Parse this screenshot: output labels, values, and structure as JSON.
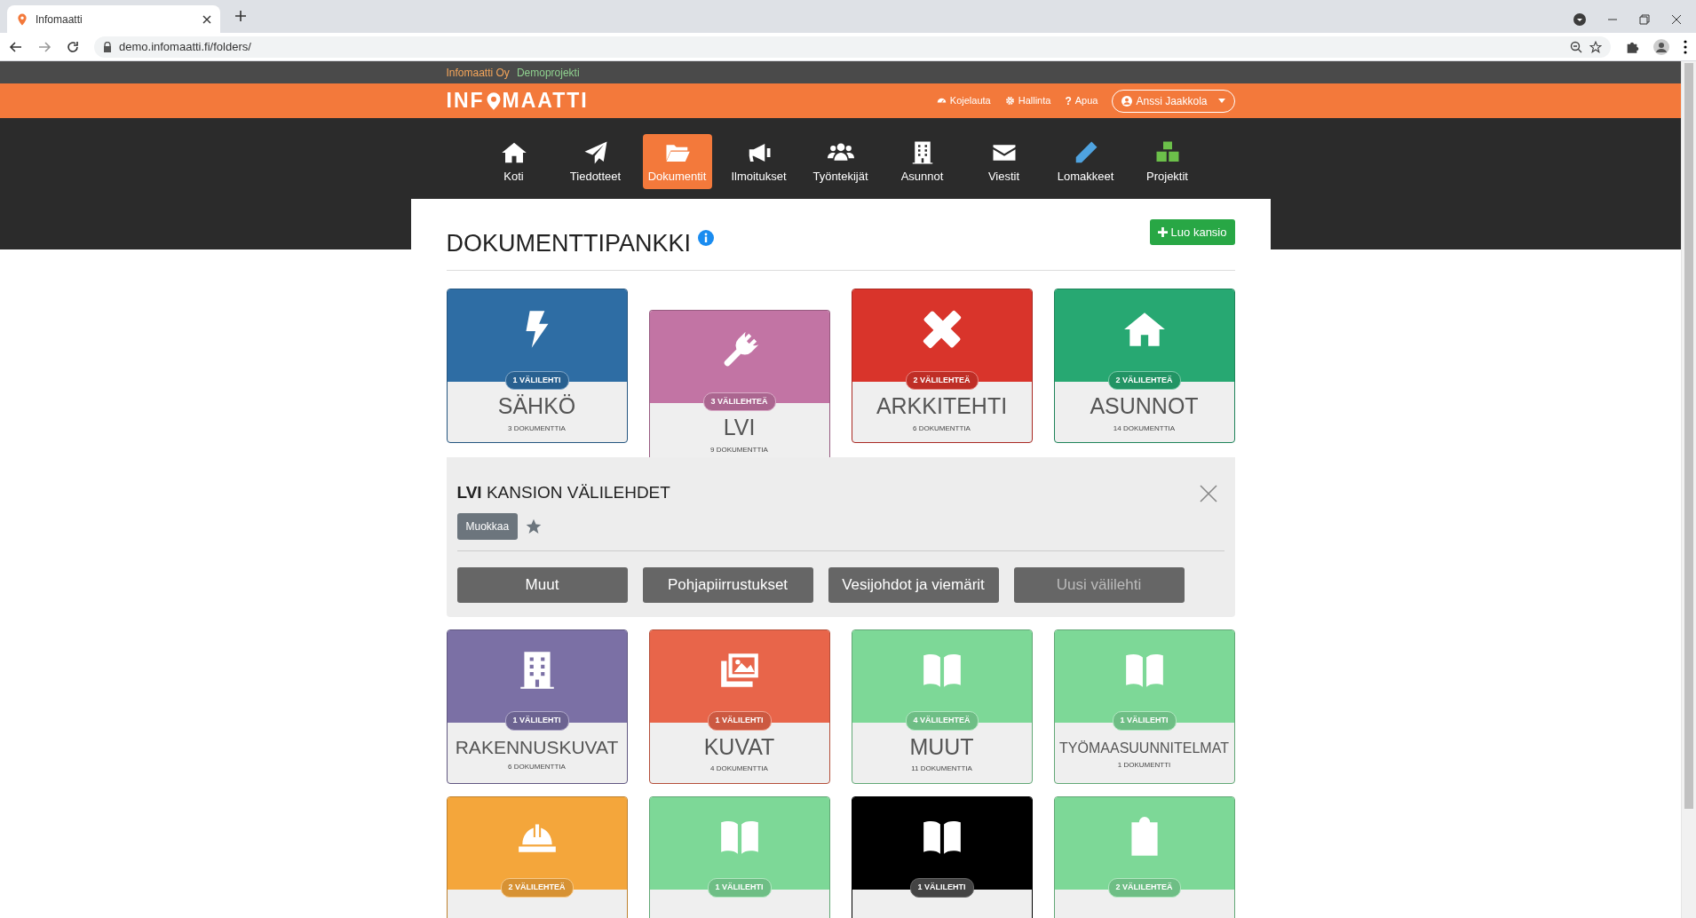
{
  "browser": {
    "tab_title": "Infomaatti",
    "url": "demo.infomaatti.fi/folders/"
  },
  "topbar": {
    "company": "Infomaatti Oy",
    "project": "Demoprojekti"
  },
  "header": {
    "logo_parts": [
      "INF",
      "MAATTI"
    ],
    "links": [
      {
        "label": "Kojelauta"
      },
      {
        "label": "Hallinta"
      },
      {
        "label": "Apua",
        "glyph": "?"
      }
    ],
    "user": "Anssi Jaakkola"
  },
  "nav": [
    {
      "label": "Koti",
      "selected": false
    },
    {
      "label": "Tiedotteet",
      "selected": false
    },
    {
      "label": "Dokumentit",
      "selected": true
    },
    {
      "label": "Ilmoitukset",
      "selected": false
    },
    {
      "label": "Työntekijät",
      "selected": false
    },
    {
      "label": "Asunnot",
      "selected": false
    },
    {
      "label": "Viestit",
      "selected": false
    },
    {
      "label": "Lomakkeet",
      "selected": false
    },
    {
      "label": "Projektit",
      "selected": false
    }
  ],
  "page": {
    "title": "DOKUMENTTIPANKKI",
    "create_button": "Luo kansio"
  },
  "folders": [
    {
      "name": "SÄHKÖ",
      "count": "3 DOKUMENTTIA",
      "tabs": "1 VÄLILEHTI",
      "color": "#2e6da4",
      "selected": false
    },
    {
      "name": "LVI",
      "count": "9 DOKUMENTTIA",
      "tabs": "3 VÄLILEHTEÄ",
      "color": "#c274a4",
      "selected": true
    },
    {
      "name": "ARKKITEHTI",
      "count": "6 DOKUMENTTIA",
      "tabs": "2 VÄLILEHTEÄ",
      "color": "#d9342b",
      "selected": false
    },
    {
      "name": "ASUNNOT",
      "count": "14 DOKUMENTTIA",
      "tabs": "2 VÄLILEHTEÄ",
      "color": "#27a872",
      "selected": false
    },
    {
      "name": "RAKENNUSKUVAT",
      "count": "6 DOKUMENTTIA",
      "tabs": "1 VÄLILEHTI",
      "color": "#7b70a5",
      "selected": false
    },
    {
      "name": "KUVAT",
      "count": "4 DOKUMENTTIA",
      "tabs": "1 VÄLILEHTI",
      "color": "#e8654a",
      "selected": false
    },
    {
      "name": "MUUT",
      "count": "11 DOKUMENTTIA",
      "tabs": "4 VÄLILEHTEÄ",
      "color": "#7dd897",
      "selected": false
    },
    {
      "name": "TYÖMAASUUNNITELMAT",
      "count": "1 DOKUMENTTI",
      "tabs": "1 VÄLILEHTI",
      "color": "#7dd897",
      "selected": false
    },
    {
      "tabs": "2 VÄLILEHTEÄ",
      "color": "#f4a63b",
      "selected": false
    },
    {
      "tabs": "1 VÄLILEHTI",
      "color": "#7dd897",
      "selected": false
    },
    {
      "tabs": "1 VÄLILEHTI",
      "color": "#000000",
      "selected": false
    },
    {
      "tabs": "2 VÄLILEHTEÄ",
      "color": "#7dd897",
      "selected": false
    }
  ],
  "panel": {
    "title": "**LVI** KANSION VÄLILEHDET",
    "edit_button": "Muokkaa",
    "tabs": [
      {
        "label": "Muut",
        "kind": "tab"
      },
      {
        "label": "Pohjapiirrustukset",
        "kind": "tab"
      },
      {
        "label": "Vesijohdot ja viemärit",
        "kind": "tab"
      },
      {
        "label": "Uusi välilehti",
        "kind": "new"
      }
    ]
  }
}
